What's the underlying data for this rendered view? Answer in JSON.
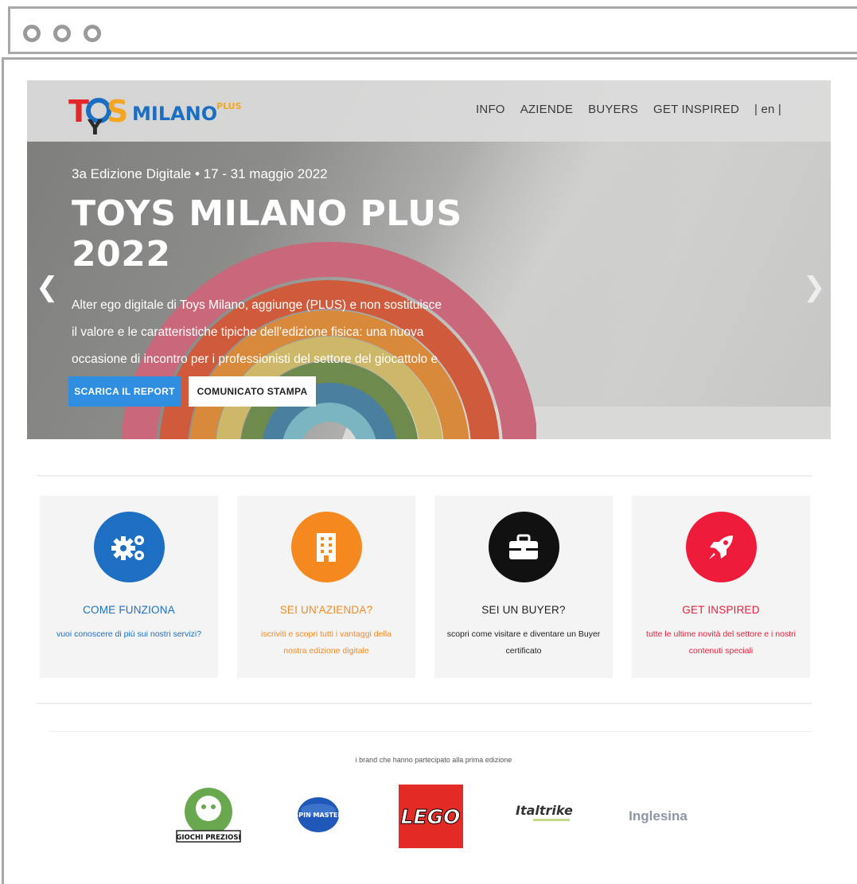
{
  "nav": {
    "logo_text": "TOYS MILANO PLUS",
    "items": [
      "INFO",
      "AZIENDE",
      "BUYERS",
      "GET INSPIRED",
      "| en |"
    ]
  },
  "hero": {
    "edition": "3a Edizione Digitale • 17 - 31 maggio 2022",
    "title": "TOYS MILANO PLUS 2022",
    "description": "Alter ego digitale di Toys Milano, aggiunge (PLUS) e non sostituisce il valore e le caratteristiche tipiche dell'edizione fisica: una nuova occasione di incontro per i professionisti del settore del giocattolo e della prima infanzia.",
    "primary_button": "SCARICA IL REPORT",
    "secondary_button": "COMUNICATO STAMPA"
  },
  "cards": [
    {
      "title": "COME FUNZIONA",
      "description": "vuoi conoscere di più sui nostri servizi?",
      "color": "#1d6fc4",
      "icon": "gears-icon"
    },
    {
      "title": "SEI UN'AZIENDA?",
      "description": "iscriviti e scopri tutti i vantaggi della nostra edizione digitale",
      "color": "#f5891f",
      "icon": "building-icon"
    },
    {
      "title": "SEI UN BUYER?",
      "description": "scopri come visitare e diventare un Buyer certificato",
      "color": "#111111",
      "icon": "briefcase-icon"
    },
    {
      "title": "GET INSPIRED",
      "description": "tutte le ultime novità del settore e i nostri contenuti speciali",
      "color": "#ee1c3a",
      "icon": "rocket-icon"
    }
  ],
  "brands": {
    "caption": "i brand che hanno partecipato alla prima edizione",
    "logos": [
      "GIOCHI PREZIOSI",
      "SPIN MASTER",
      "LEGO",
      "Italtrike",
      "Inglesina"
    ]
  }
}
